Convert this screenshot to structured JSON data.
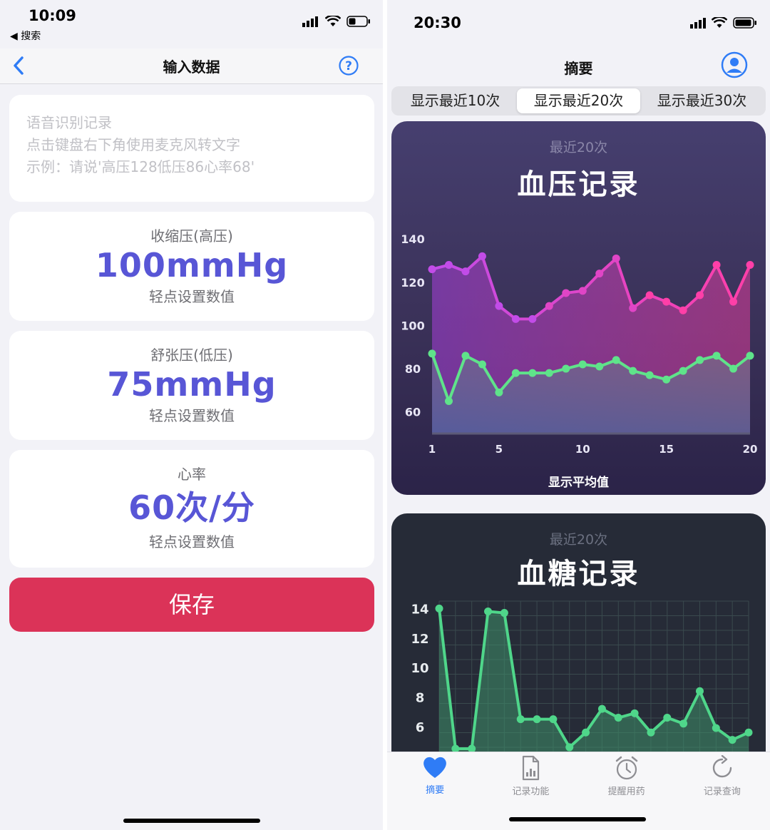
{
  "left_screen": {
    "status": {
      "time": "10:09",
      "back_app": "◀ 搜索"
    },
    "nav": {
      "title": "输入数据"
    },
    "voice_card": {
      "title": "语音识别记录",
      "line1": "点击键盘右下角使用麦克风转文字",
      "line2": "示例：请说'高压128低压86心率68'"
    },
    "systolic": {
      "label": "收缩压(高压)",
      "value": "100mmHg",
      "hint": "轻点设置数值"
    },
    "diastolic": {
      "label": "舒张压(低压)",
      "value": "75mmHg",
      "hint": "轻点设置数值"
    },
    "heart_rate": {
      "label": "心率",
      "value": "60次/分",
      "hint": "轻点设置数值"
    },
    "save_label": "保存"
  },
  "right_screen": {
    "status": {
      "time": "20:30"
    },
    "nav": {
      "title": "摘要"
    },
    "segments": [
      "显示最近10次",
      "显示最近20次",
      "显示最近30次"
    ],
    "selected_segment": 1,
    "bp_card": {
      "subtitle": "最近20次",
      "title": "血压记录",
      "footer": "显示平均值"
    },
    "bg_card": {
      "subtitle": "最近20次",
      "title": "血糖记录"
    },
    "tabs": [
      {
        "label": "摘要",
        "icon": "heart-icon",
        "active": true
      },
      {
        "label": "记录功能",
        "icon": "document-chart-icon",
        "active": false
      },
      {
        "label": "提醒用药",
        "icon": "alarm-clock-icon",
        "active": false
      },
      {
        "label": "记录查询",
        "icon": "history-icon",
        "active": false
      }
    ]
  },
  "colors": {
    "accent_purple": "#5856d6",
    "save_red": "#db3358",
    "systolic_line": "#ff3fa8",
    "diastolic_line": "#5fe38a",
    "glucose_line": "#4fd68a",
    "tab_active": "#2f7cf6"
  },
  "chart_data": [
    {
      "type": "line",
      "title": "血压记录",
      "subtitle": "最近20次",
      "x": [
        1,
        2,
        3,
        4,
        5,
        6,
        7,
        8,
        9,
        10,
        11,
        12,
        13,
        14,
        15,
        16,
        17,
        18,
        19,
        20
      ],
      "x_ticks": [
        1,
        5,
        10,
        15,
        20
      ],
      "y_ticks": [
        60,
        80,
        100,
        120,
        140
      ],
      "ylim": [
        50,
        145
      ],
      "series": [
        {
          "values": [
            126,
            128,
            125,
            132,
            109,
            103,
            103,
            109,
            115,
            116,
            124,
            131,
            108,
            114,
            111,
            107,
            114,
            128,
            111,
            128
          ]
        },
        {
          "values": [
            87,
            65,
            86,
            82,
            69,
            78,
            78,
            78,
            80,
            82,
            81,
            84,
            79,
            77,
            75,
            79,
            84,
            86,
            80,
            86
          ]
        }
      ],
      "footer": "显示平均值",
      "grid": false
    },
    {
      "type": "area",
      "title": "血糖记录",
      "subtitle": "最近20次",
      "x": [
        1,
        2,
        3,
        4,
        5,
        6,
        7,
        8,
        9,
        10,
        11,
        12,
        13,
        14,
        15,
        16,
        17,
        18,
        19,
        20
      ],
      "y_ticks": [
        6,
        8,
        10,
        12,
        14
      ],
      "ylim": [
        4.5,
        14.5
      ],
      "series": [
        {
          "values": [
            14,
            4.5,
            4.5,
            13.8,
            13.7,
            6.5,
            6.5,
            6.5,
            4.6,
            5.6,
            7.2,
            6.6,
            6.9,
            5.6,
            6.6,
            6.2,
            8.4,
            5.9,
            5.1,
            5.6
          ]
        }
      ],
      "grid": true
    }
  ]
}
